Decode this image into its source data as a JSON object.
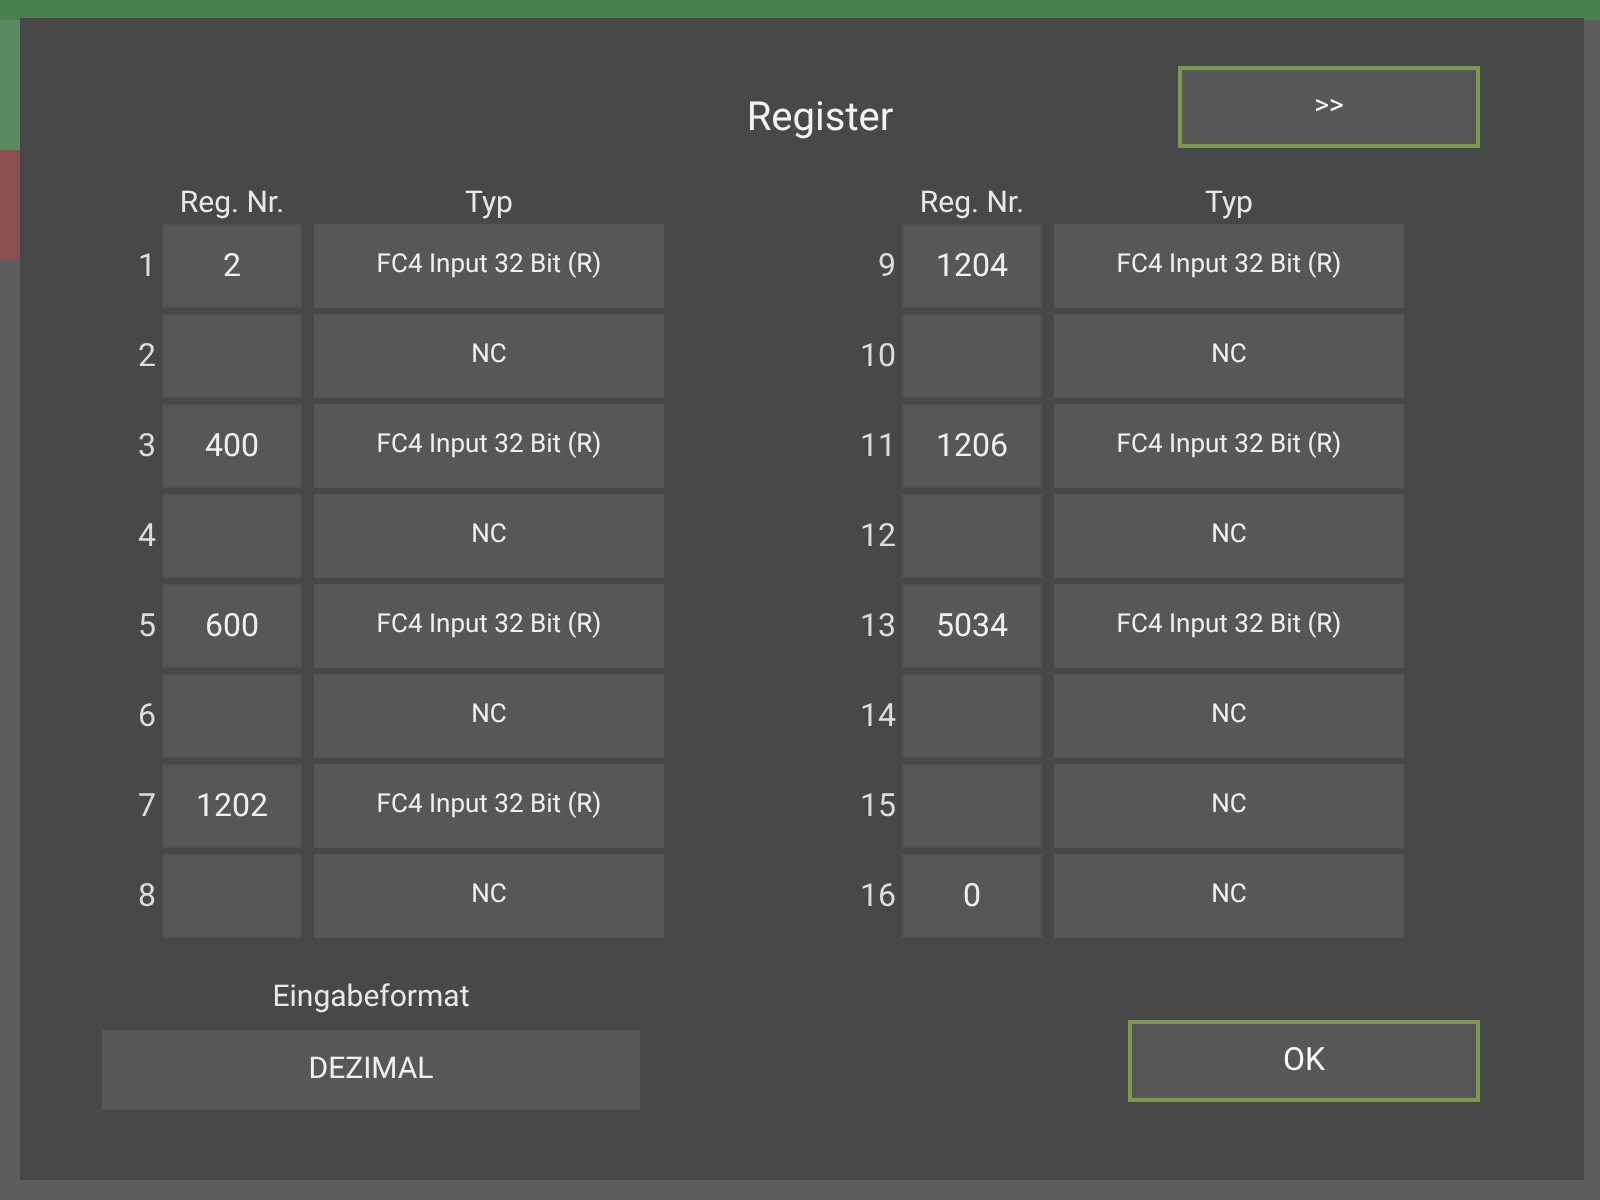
{
  "dialog": {
    "title": "Register",
    "next_button": ">>",
    "tables": [
      {
        "headers": {
          "reg": "Reg. Nr.",
          "typ": "Typ"
        },
        "rows": [
          {
            "number": "1",
            "reg": "2",
            "typ": "FC4 Input 32 Bit (R)"
          },
          {
            "number": "2",
            "typ": "NC"
          },
          {
            "number": "3",
            "reg": "400",
            "typ": "FC4 Input 32 Bit (R)"
          },
          {
            "number": "4",
            "typ": "NC"
          },
          {
            "number": "5",
            "reg": "600",
            "typ": "FC4 Input 32 Bit (R)"
          },
          {
            "number": "6",
            "typ": "NC"
          },
          {
            "number": "7",
            "reg": "1202",
            "typ": "FC4 Input 32 Bit (R)"
          },
          {
            "number": "8",
            "typ": "NC"
          }
        ]
      },
      {
        "headers": {
          "reg": "Reg. Nr.",
          "typ": "Typ"
        },
        "rows": [
          {
            "number": "9",
            "reg": "1204",
            "typ": "FC4 Input 32 Bit (R)"
          },
          {
            "number": "10",
            "typ": "NC"
          },
          {
            "number": "11",
            "reg": "1206",
            "typ": "FC4 Input 32 Bit (R)"
          },
          {
            "number": "12",
            "typ": "NC"
          },
          {
            "number": "13",
            "reg": "5034",
            "typ": "FC4 Input 32 Bit (R)"
          },
          {
            "number": "14",
            "typ": "NC"
          },
          {
            "number": "15",
            "typ": "NC"
          },
          {
            "number": "16",
            "reg": "0",
            "typ": "NC"
          }
        ]
      }
    ],
    "format": {
      "label": "Eingabeformat",
      "value": "DEZIMAL"
    },
    "ok_button": "OK"
  }
}
